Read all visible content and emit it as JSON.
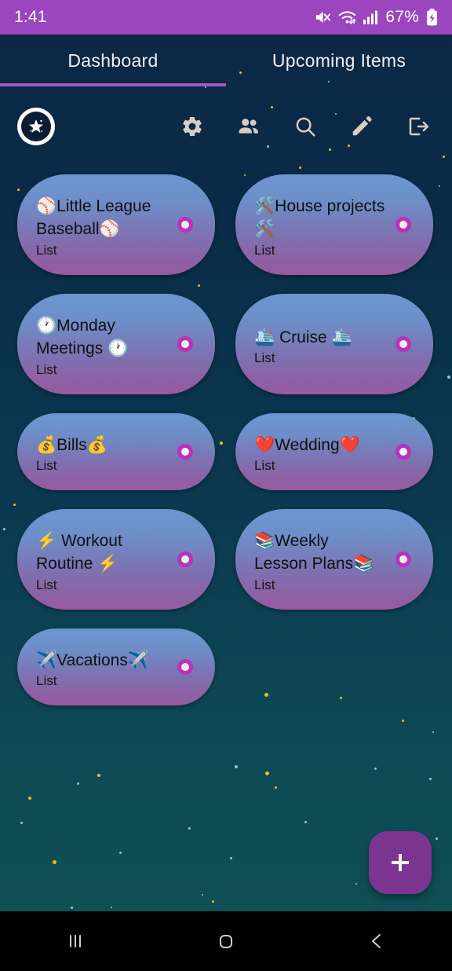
{
  "statusbar": {
    "time": "1:41",
    "battery_percent": "67%",
    "icons": [
      "mute-icon",
      "wifi-icon",
      "cellular-signal-icon",
      "battery-charging-icon"
    ],
    "background_color": "#9b45be"
  },
  "tabs": [
    {
      "label": "Dashboard",
      "active": true
    },
    {
      "label": "Upcoming Items",
      "active": false
    }
  ],
  "toolbar": {
    "logo_name": "app-logo-star",
    "actions": [
      {
        "name": "settings-icon",
        "label": "Settings"
      },
      {
        "name": "people-icon",
        "label": "Shared users"
      },
      {
        "name": "search-icon",
        "label": "Search"
      },
      {
        "name": "edit-icon",
        "label": "Edit"
      },
      {
        "name": "logout-icon",
        "label": "Log out"
      }
    ]
  },
  "cards": [
    {
      "title": "⚾Little League Baseball⚾",
      "subtitle": "List",
      "lines": 2
    },
    {
      "title": "🛠️House projects🛠️",
      "subtitle": "List",
      "lines": 2
    },
    {
      "title": "🕐Monday Meetings 🕐",
      "subtitle": "List",
      "lines": 2
    },
    {
      "title": "🛳️ Cruise 🛳️",
      "subtitle": "List",
      "lines": 1
    },
    {
      "title": "💰Bills💰",
      "subtitle": "List",
      "lines": 1
    },
    {
      "title": "❤️Wedding❤️",
      "subtitle": "List",
      "lines": 1
    },
    {
      "title": "⚡ Workout Routine ⚡",
      "subtitle": "List",
      "lines": 2
    },
    {
      "title": "📚Weekly Lesson Plans📚",
      "subtitle": "List",
      "lines": 2
    },
    {
      "title": "✈️Vacations✈️",
      "subtitle": "List",
      "lines": 1
    }
  ],
  "fab": {
    "label": "+",
    "name": "add-button",
    "color": "#7b3590"
  },
  "navbar": [
    {
      "name": "recents-button",
      "glyph": "|||"
    },
    {
      "name": "home-button",
      "glyph": "▢"
    },
    {
      "name": "back-button",
      "glyph": "‹"
    }
  ],
  "theme": {
    "accent": "#a855c8",
    "card_top": "#6c96d1",
    "card_bottom": "#975aa0",
    "dot": "#b733b7",
    "bg_top": "#0b2744",
    "bg_bottom": "#0f4f55"
  }
}
